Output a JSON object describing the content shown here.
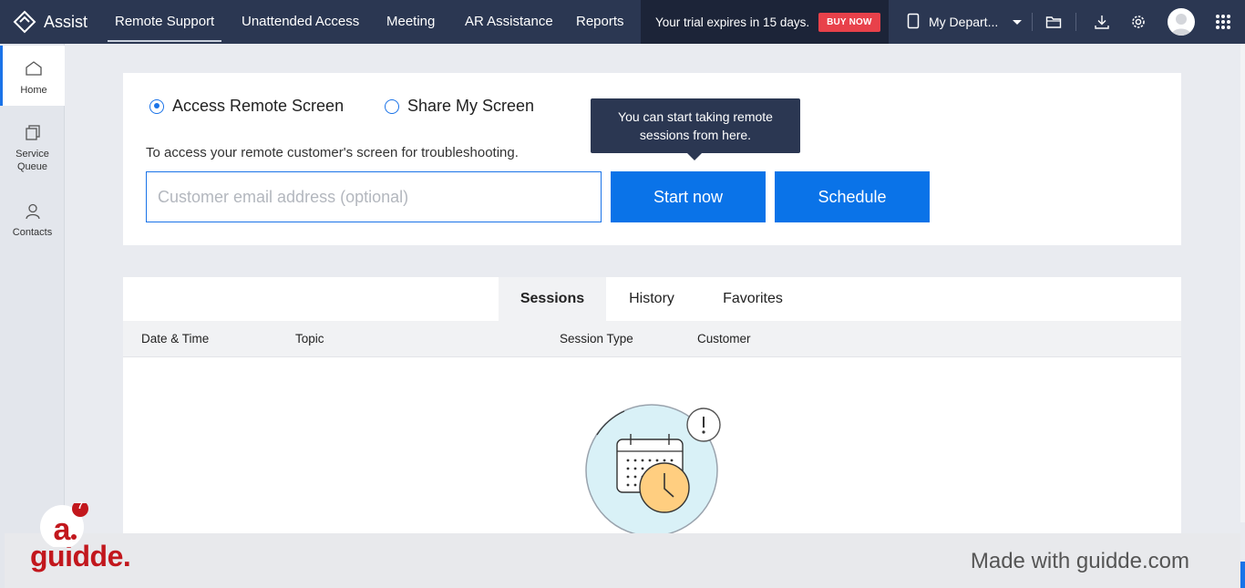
{
  "brand": {
    "name": "Assist",
    "icon": "assist-logo-icon"
  },
  "nav": {
    "items": [
      {
        "label": "Remote Support",
        "active": true
      },
      {
        "label": "Unattended Access",
        "active": false
      },
      {
        "label": "Meeting",
        "active": false
      },
      {
        "label": "AR Assistance",
        "active": false
      },
      {
        "label": "Reports",
        "active": false
      }
    ]
  },
  "trial": {
    "text": "Your trial expires in 15 days.",
    "buy_label": "BUY NOW"
  },
  "department": {
    "label": "My Depart...",
    "icon": "department-icon"
  },
  "toolbar_icons": [
    "folder-icon",
    "download-icon",
    "settings-icon",
    "apps-grid-icon"
  ],
  "sidebar": {
    "items": [
      {
        "label": "Home",
        "icon": "home-icon",
        "active": true
      },
      {
        "label": "Service Queue",
        "label_line1": "Service",
        "label_line2": "Queue",
        "icon": "service-queue-icon"
      },
      {
        "label": "Contacts",
        "icon": "contacts-icon"
      }
    ]
  },
  "session_start": {
    "options": [
      {
        "label": "Access Remote Screen",
        "selected": true
      },
      {
        "label": "Share My Screen",
        "selected": false
      }
    ],
    "description": "To access your remote customer's screen for troubleshooting.",
    "email_placeholder": "Customer email address (optional)",
    "email_value": "",
    "start_label": "Start now",
    "schedule_label": "Schedule",
    "tooltip_line1": "You can start taking remote",
    "tooltip_line2": "sessions from here."
  },
  "sessions_panel": {
    "tabs": [
      {
        "label": "Sessions",
        "active": true
      },
      {
        "label": "History",
        "active": false
      },
      {
        "label": "Favorites",
        "active": false
      }
    ],
    "columns": [
      "Date & Time",
      "Topic",
      "Session Type",
      "Customer"
    ],
    "rows": [],
    "empty_icon": "empty-calendar-clock-icon"
  },
  "footer": {
    "logo_text": "guidde.",
    "made_with": "Made with guidde.com",
    "badge_count": "7"
  },
  "colors": {
    "nav_bg": "#2b3752",
    "primary": "#0a73e8",
    "buy_now": "#e8414a",
    "guidde_red": "#c2171d"
  }
}
